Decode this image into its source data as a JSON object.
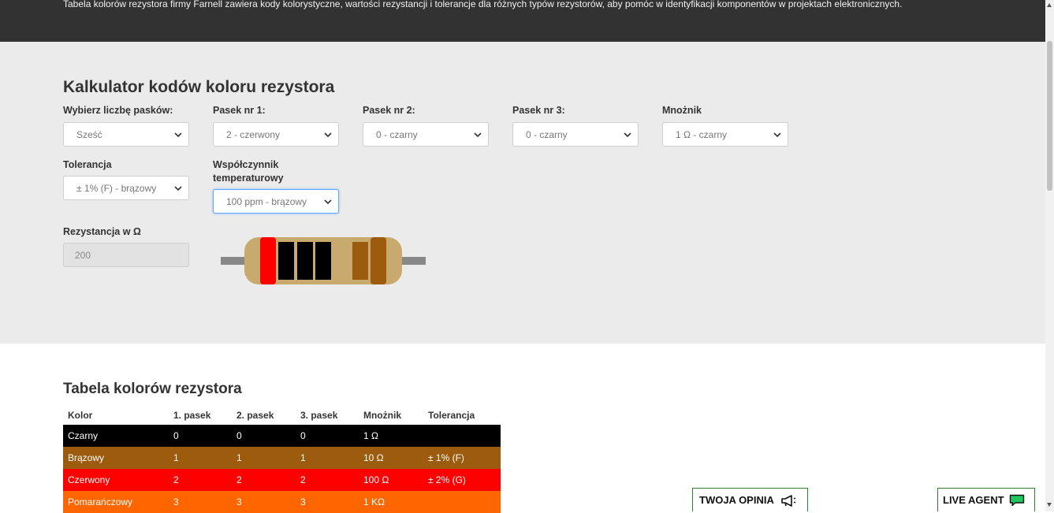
{
  "header": {
    "description": "Tabela kolorów rezystora firmy Farnell zawiera kody kolorystyczne, wartości rezystancji i tolerancje dla różnych typów rezystorów, aby pomóc w identyfikacji komponentów w projektach elektronicznych."
  },
  "calculator": {
    "title": "Kalkulator kodów koloru rezystora",
    "bands_count": {
      "label": "Wybierz liczbę pasków:",
      "value": "Sześć"
    },
    "band1": {
      "label": "Pasek nr 1:",
      "value": "2 - czerwony"
    },
    "band2": {
      "label": "Pasek nr 2:",
      "value": "0 - czarny"
    },
    "band3": {
      "label": "Pasek nr 3:",
      "value": "0 - czarny"
    },
    "multiplier": {
      "label": "Mnożnik",
      "value": "1 Ω - czarny"
    },
    "tolerance": {
      "label": "Tolerancja",
      "value": "± 1% (F) - brązowy"
    },
    "tempco": {
      "label_line1": "Współczynnik",
      "label_line2": "temperaturowy",
      "value": "100 ppm - brązowy"
    },
    "resistance": {
      "label": "Rezystancja w Ω",
      "value": "200"
    },
    "resistor_colors": {
      "body": "#c8a96e",
      "lead": "#888888",
      "bands": [
        "#ff0000",
        "#000000",
        "#000000",
        "#000000",
        "#9c5b0d",
        "#9c5b0d"
      ]
    }
  },
  "color_table": {
    "title": "Tabela kolorów rezystora",
    "headers": [
      "Kolor",
      "1. pasek",
      "2. pasek",
      "3. pasek",
      "Mnożnik",
      "Tolerancja"
    ],
    "rows": [
      {
        "bg": "#000000",
        "cells": [
          "Czarny",
          "0",
          "0",
          "0",
          "1 Ω",
          ""
        ]
      },
      {
        "bg": "#9c5b0d",
        "cells": [
          "Brązowy",
          "1",
          "1",
          "1",
          "10 Ω",
          "± 1% (F)"
        ]
      },
      {
        "bg": "#ff0000",
        "cells": [
          "Czerwony",
          "2",
          "2",
          "2",
          "100 Ω",
          "± 2% (G)"
        ]
      },
      {
        "bg": "#ff6600",
        "cells": [
          "Pomarańczowy",
          "3",
          "3",
          "3",
          "1 KΩ",
          ""
        ]
      }
    ]
  },
  "floating": {
    "feedback_label": "TWOJA OPINIA",
    "feedback_icon": "megaphone-icon",
    "live_agent_label": "LIVE AGENT",
    "live_agent_icon": "chat-bubble-icon",
    "accent": "#2e7d32",
    "chat_color": "#22c55e"
  }
}
